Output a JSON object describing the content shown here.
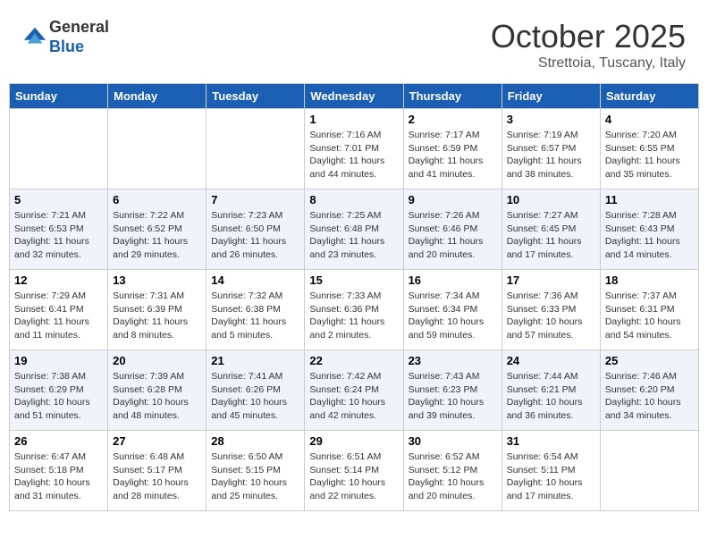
{
  "header": {
    "logo_line1": "General",
    "logo_line2": "Blue",
    "month_title": "October 2025",
    "location": "Strettoia, Tuscany, Italy"
  },
  "days_of_week": [
    "Sunday",
    "Monday",
    "Tuesday",
    "Wednesday",
    "Thursday",
    "Friday",
    "Saturday"
  ],
  "weeks": [
    [
      {
        "day": "",
        "info": ""
      },
      {
        "day": "",
        "info": ""
      },
      {
        "day": "",
        "info": ""
      },
      {
        "day": "1",
        "info": "Sunrise: 7:16 AM\nSunset: 7:01 PM\nDaylight: 11 hours and 44 minutes."
      },
      {
        "day": "2",
        "info": "Sunrise: 7:17 AM\nSunset: 6:59 PM\nDaylight: 11 hours and 41 minutes."
      },
      {
        "day": "3",
        "info": "Sunrise: 7:19 AM\nSunset: 6:57 PM\nDaylight: 11 hours and 38 minutes."
      },
      {
        "day": "4",
        "info": "Sunrise: 7:20 AM\nSunset: 6:55 PM\nDaylight: 11 hours and 35 minutes."
      }
    ],
    [
      {
        "day": "5",
        "info": "Sunrise: 7:21 AM\nSunset: 6:53 PM\nDaylight: 11 hours and 32 minutes."
      },
      {
        "day": "6",
        "info": "Sunrise: 7:22 AM\nSunset: 6:52 PM\nDaylight: 11 hours and 29 minutes."
      },
      {
        "day": "7",
        "info": "Sunrise: 7:23 AM\nSunset: 6:50 PM\nDaylight: 11 hours and 26 minutes."
      },
      {
        "day": "8",
        "info": "Sunrise: 7:25 AM\nSunset: 6:48 PM\nDaylight: 11 hours and 23 minutes."
      },
      {
        "day": "9",
        "info": "Sunrise: 7:26 AM\nSunset: 6:46 PM\nDaylight: 11 hours and 20 minutes."
      },
      {
        "day": "10",
        "info": "Sunrise: 7:27 AM\nSunset: 6:45 PM\nDaylight: 11 hours and 17 minutes."
      },
      {
        "day": "11",
        "info": "Sunrise: 7:28 AM\nSunset: 6:43 PM\nDaylight: 11 hours and 14 minutes."
      }
    ],
    [
      {
        "day": "12",
        "info": "Sunrise: 7:29 AM\nSunset: 6:41 PM\nDaylight: 11 hours and 11 minutes."
      },
      {
        "day": "13",
        "info": "Sunrise: 7:31 AM\nSunset: 6:39 PM\nDaylight: 11 hours and 8 minutes."
      },
      {
        "day": "14",
        "info": "Sunrise: 7:32 AM\nSunset: 6:38 PM\nDaylight: 11 hours and 5 minutes."
      },
      {
        "day": "15",
        "info": "Sunrise: 7:33 AM\nSunset: 6:36 PM\nDaylight: 11 hours and 2 minutes."
      },
      {
        "day": "16",
        "info": "Sunrise: 7:34 AM\nSunset: 6:34 PM\nDaylight: 10 hours and 59 minutes."
      },
      {
        "day": "17",
        "info": "Sunrise: 7:36 AM\nSunset: 6:33 PM\nDaylight: 10 hours and 57 minutes."
      },
      {
        "day": "18",
        "info": "Sunrise: 7:37 AM\nSunset: 6:31 PM\nDaylight: 10 hours and 54 minutes."
      }
    ],
    [
      {
        "day": "19",
        "info": "Sunrise: 7:38 AM\nSunset: 6:29 PM\nDaylight: 10 hours and 51 minutes."
      },
      {
        "day": "20",
        "info": "Sunrise: 7:39 AM\nSunset: 6:28 PM\nDaylight: 10 hours and 48 minutes."
      },
      {
        "day": "21",
        "info": "Sunrise: 7:41 AM\nSunset: 6:26 PM\nDaylight: 10 hours and 45 minutes."
      },
      {
        "day": "22",
        "info": "Sunrise: 7:42 AM\nSunset: 6:24 PM\nDaylight: 10 hours and 42 minutes."
      },
      {
        "day": "23",
        "info": "Sunrise: 7:43 AM\nSunset: 6:23 PM\nDaylight: 10 hours and 39 minutes."
      },
      {
        "day": "24",
        "info": "Sunrise: 7:44 AM\nSunset: 6:21 PM\nDaylight: 10 hours and 36 minutes."
      },
      {
        "day": "25",
        "info": "Sunrise: 7:46 AM\nSunset: 6:20 PM\nDaylight: 10 hours and 34 minutes."
      }
    ],
    [
      {
        "day": "26",
        "info": "Sunrise: 6:47 AM\nSunset: 5:18 PM\nDaylight: 10 hours and 31 minutes."
      },
      {
        "day": "27",
        "info": "Sunrise: 6:48 AM\nSunset: 5:17 PM\nDaylight: 10 hours and 28 minutes."
      },
      {
        "day": "28",
        "info": "Sunrise: 6:50 AM\nSunset: 5:15 PM\nDaylight: 10 hours and 25 minutes."
      },
      {
        "day": "29",
        "info": "Sunrise: 6:51 AM\nSunset: 5:14 PM\nDaylight: 10 hours and 22 minutes."
      },
      {
        "day": "30",
        "info": "Sunrise: 6:52 AM\nSunset: 5:12 PM\nDaylight: 10 hours and 20 minutes."
      },
      {
        "day": "31",
        "info": "Sunrise: 6:54 AM\nSunset: 5:11 PM\nDaylight: 10 hours and 17 minutes."
      },
      {
        "day": "",
        "info": ""
      }
    ]
  ]
}
